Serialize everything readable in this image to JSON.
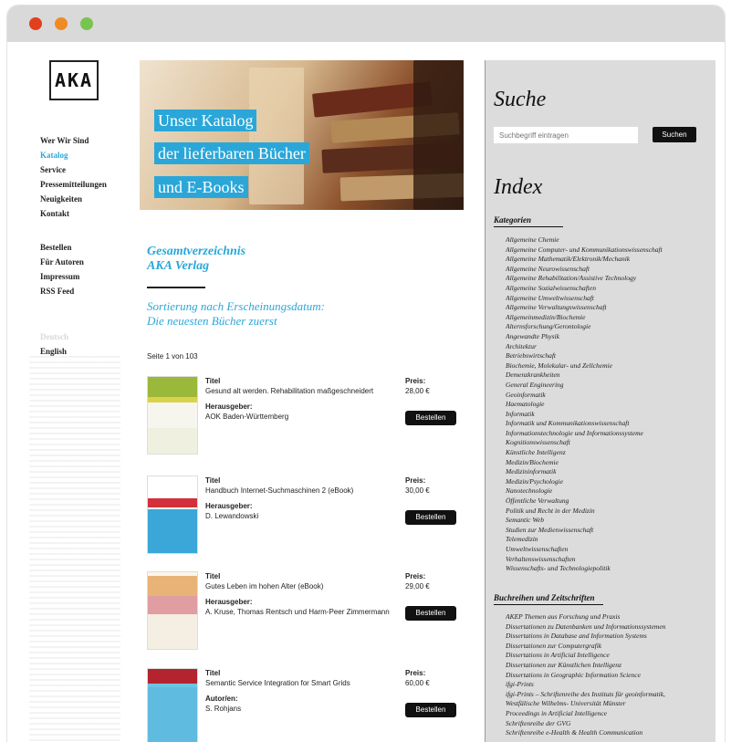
{
  "logo": "AKA",
  "nav": {
    "primary": [
      "Wer Wir Sind",
      "Katalog",
      "Service",
      "Pressemitteilungen",
      "Neuigkeiten",
      "Kontakt"
    ],
    "secondary": [
      "Bestellen",
      "Für Autoren",
      "Impressum",
      "RSS Feed"
    ],
    "lang_current": "Deutsch",
    "lang_other": "English"
  },
  "hero": {
    "line1": "Unser Katalog",
    "line2": "der lieferbaren Bücher",
    "line3": "und E-Books"
  },
  "catalog": {
    "title1": "Gesamtverzeichnis",
    "title2": "AKA Verlag",
    "sort1": "Sortierung nach Erscheinungsdatum:",
    "sort2": "Die neuesten Bücher zuerst",
    "page_info": "Seite 1 von 103"
  },
  "books": [
    {
      "title_label": "Titel",
      "title": "Gesund alt werden. Rehabilitation maßgeschneidert",
      "person_label": "Herausgeber:",
      "person": "AOK Baden-Württemberg",
      "price_label": "Preis:",
      "price": "28,00 €",
      "button": "Bestellen"
    },
    {
      "title_label": "Titel",
      "title": "Handbuch Internet-Suchmaschinen 2 (eBook)",
      "person_label": "Herausgeber:",
      "person": "D. Lewandowski",
      "price_label": "Preis:",
      "price": "30,00 €",
      "button": "Bestellen"
    },
    {
      "title_label": "Titel",
      "title": "Gutes Leben im hohen Alter (eBook)",
      "person_label": "Herausgeber:",
      "person": "A. Kruse, Thomas Rentsch und Harm-Peer Zimmermann",
      "price_label": "Preis:",
      "price": "29,00 €",
      "button": "Bestellen"
    },
    {
      "title_label": "Titel",
      "title": "Semantic Service Integration for Smart Grids",
      "person_label": "Autor/en:",
      "person": "S. Rohjans",
      "price_label": "Preis:",
      "price": "60,00 €",
      "button": "Bestellen"
    }
  ],
  "search": {
    "heading": "Suche",
    "placeholder": "Suchbegriff eintragen",
    "button": "Suchen"
  },
  "index": {
    "heading": "Index",
    "categories_heading": "Kategorien",
    "categories": [
      "Allgemeine Chemie",
      "Allgemeine Computer- und Kommunikationswissenschaft",
      "Allgemeine Mathematik/Elektronik/Mechanik",
      "Allgemeine Neurowissenschaft",
      "Allgemeine Rehabilitation/Assistive Technology",
      "Allgemeine Sozialwissenschaften",
      "Allgemeine Umweltwissenschaft",
      "Allgemeine Verwaltungswissenschaft",
      "Allgemeinmedizin/Biochemie",
      "Alternsforschung/Gerontologie",
      "Angewandte Physik",
      "Architektur",
      "Betriebswirtschaft",
      "Biochemie, Molekular- und Zellchemie",
      "Demenzkrankheiten",
      "General Engineering",
      "Geoinformatik",
      "Haematologie",
      "Informatik",
      "Informatik und Kommunikationswissenschaft",
      "Informationstechnologie und Informationssysteme",
      "Kognitionswissenschaft",
      "Künstliche Intelligenz",
      "Medizin/Biochemie",
      "Medizininformatik",
      "Medizin/Psychologie",
      "Nanotechnologie",
      "Öffentliche Verwaltung",
      "Politik und Recht in der Medizin",
      "Semantic Web",
      "Studien zur Medienwissenschaft",
      "Telemedizin",
      "Umweltwissenschaften",
      "Verhaltenswissenschaften",
      "Wissenschafts- und Technologiepolitik"
    ],
    "series_heading": "Buchreihen und Zeitschriften",
    "series": [
      "AKEP Themen aus Forschung und Praxis",
      "Dissertationen zu Datenbanken und Informationssystemen",
      "Dissertations in Database and Information Systems",
      "Dissertationen zur Computergrafik",
      "Dissertations in Artificial Intelligence",
      "Dissertationen zur Künstlichen Intelligenz",
      "Dissertations in Geographic Information Science",
      "ifgi-Prints",
      "ifgi-Prints – Schriftenreihe des Instituts für geoinformatik,",
      "Westfälische Wilhelms- Universität Münster",
      "Proceedings in Artificial Intelligence",
      "Schriftenreihe der GVG",
      "Schriftenreihe e-Health & Health Communication"
    ]
  },
  "colors": {
    "accent": "#2aa7d8",
    "sidebar_bg": "#dcdcdc",
    "button_bg": "#111111"
  }
}
